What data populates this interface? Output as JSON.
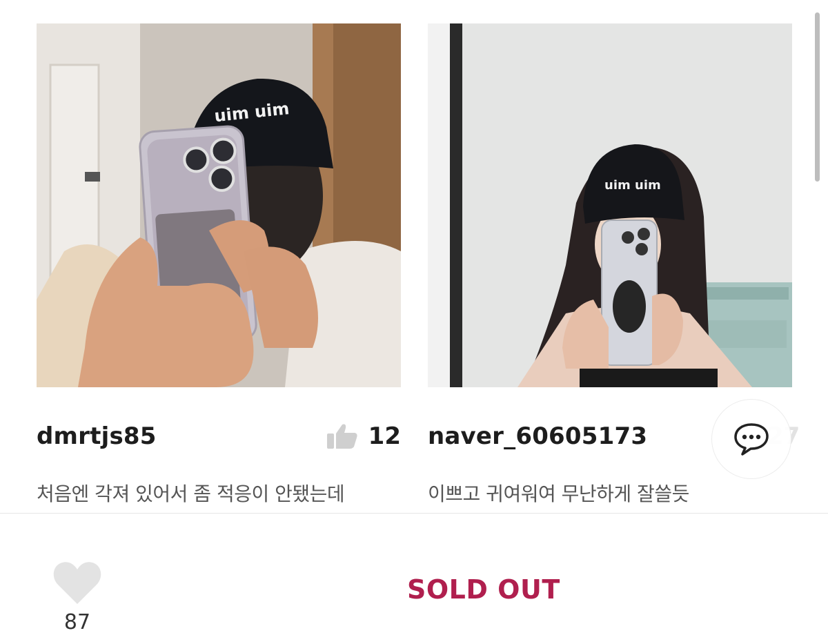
{
  "reviews": [
    {
      "username": "dmrtjs85",
      "likes": "12",
      "text": "처음엔 각져 있어서 좀 적응이 안됐는데",
      "cap_text": "uim uim"
    },
    {
      "username": "naver_60605173",
      "likes": "27",
      "text": "이쁘고 귀여워여 무난하게 잘쓸듯",
      "cap_text": "uim uim"
    }
  ],
  "bottom_bar": {
    "wish_count": "87",
    "status_label": "SOLD OUT"
  },
  "colors": {
    "sold_out": "#b01f4e",
    "like_icon": "#cfcfcf",
    "heart_icon": "#e3e3e3"
  },
  "icons": {
    "like": "thumbs-up-icon",
    "wish": "heart-icon",
    "chat": "chat-bubble-icon"
  }
}
